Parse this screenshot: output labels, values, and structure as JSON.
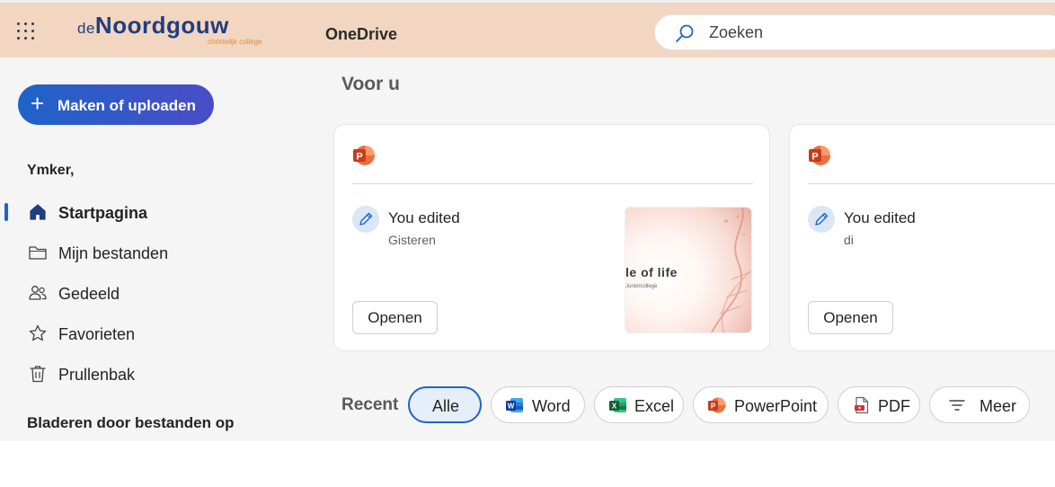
{
  "header": {
    "logo": {
      "prefix": "de",
      "main": "Noordgouw",
      "tagline": "christelijk college"
    },
    "app_name": "OneDrive",
    "search": {
      "placeholder": "Zoeken",
      "value": ""
    }
  },
  "sidebar": {
    "create_button": "Maken of uploaden",
    "user_name": "Ymker,",
    "items": [
      {
        "label": "Startpagina",
        "icon": "home-icon",
        "active": true
      },
      {
        "label": "Mijn bestanden",
        "icon": "folder-icon",
        "active": false
      },
      {
        "label": "Gedeeld",
        "icon": "people-icon",
        "active": false
      },
      {
        "label": "Favorieten",
        "icon": "star-icon",
        "active": false
      },
      {
        "label": "Prullenbak",
        "icon": "trash-icon",
        "active": false
      }
    ],
    "browse_heading": "Bladeren door bestanden op"
  },
  "main": {
    "section_title": "Voor u",
    "cards": [
      {
        "file_type": "powerpoint",
        "activity": "You edited",
        "when": "Gisteren",
        "open_label": "Openen",
        "thumbnail": {
          "title": "le of life",
          "subtitle": "Juniorcollege"
        }
      },
      {
        "file_type": "powerpoint",
        "activity": "You edited",
        "when": "di",
        "open_label": "Openen"
      }
    ],
    "recent": {
      "label": "Recent",
      "filters": [
        {
          "label": "Alle",
          "icon": "",
          "selected": true
        },
        {
          "label": "Word",
          "icon": "word-icon",
          "selected": false
        },
        {
          "label": "Excel",
          "icon": "excel-icon",
          "selected": false
        },
        {
          "label": "PowerPoint",
          "icon": "powerpoint-icon",
          "selected": false
        },
        {
          "label": "PDF",
          "icon": "pdf-icon",
          "selected": false
        },
        {
          "label": "Meer",
          "icon": "filter-icon",
          "selected": false
        }
      ]
    }
  },
  "colors": {
    "header_bg": "#f2d6c2",
    "accent": "#1e64c8",
    "brand_blue": "#1f3f7f",
    "brand_orange": "#f08a24",
    "page_bg": "#f5f5f5"
  }
}
